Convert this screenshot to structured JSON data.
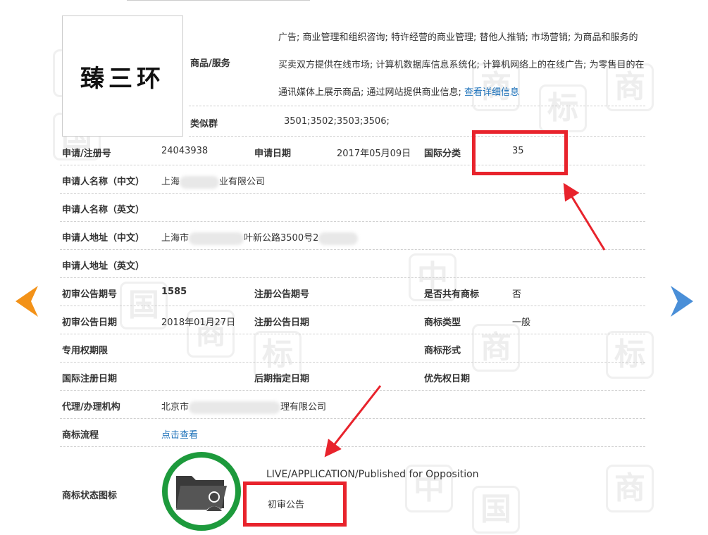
{
  "logo_text": "臻三环",
  "goods": {
    "label": "商品/服务",
    "text": "广告; 商业管理和组织咨询; 特许经营的商业管理; 替他人推销; 市场营销; 为商品和服务的买卖双方提供在线市场; 计算机数据库信息系统化; 计算机网络上的在线广告; 为零售目的在通讯媒体上展示商品; 通过网站提供商业信息; ",
    "link": "查看详细信息"
  },
  "similar_group": {
    "label": "类似群",
    "value": "3501;3502;3503;3506;"
  },
  "reg_no": {
    "label": "申请/注册号",
    "value": "24043938"
  },
  "apply_date": {
    "label": "申请日期",
    "value": "2017年05月09日"
  },
  "intl_class": {
    "label": "国际分类",
    "value": "35"
  },
  "applicant_cn": {
    "label": "申请人名称（中文）",
    "value_prefix": "上海",
    "value_suffix": "业有限公司"
  },
  "applicant_en": {
    "label": "申请人名称（英文）"
  },
  "address_cn": {
    "label": "申请人地址（中文）",
    "value_prefix": "上海市",
    "value_mid": "叶新公路3500号2"
  },
  "address_en": {
    "label": "申请人地址（英文）"
  },
  "prelim_issue": {
    "label": "初审公告期号",
    "value": "1585"
  },
  "reg_issue": {
    "label": "注册公告期号"
  },
  "shared": {
    "label": "是否共有商标",
    "value": "否"
  },
  "prelim_date": {
    "label": "初审公告日期",
    "value": "2018年01月27日"
  },
  "reg_date": {
    "label": "注册公告日期"
  },
  "mark_type": {
    "label": "商标类型",
    "value": "一般"
  },
  "exclusive_period": {
    "label": "专用权期限"
  },
  "mark_form": {
    "label": "商标形式"
  },
  "intl_reg_date": {
    "label": "国际注册日期"
  },
  "later_date": {
    "label": "后期指定日期"
  },
  "priority_date": {
    "label": "优先权日期"
  },
  "agent": {
    "label": "代理/办理机构",
    "value_prefix": "北京市",
    "value_suffix": "理有限公司"
  },
  "flow": {
    "label": "商标流程",
    "link": "点击查看"
  },
  "status": {
    "label": "商标状态图标",
    "english": "LIVE/APPLICATION/Published for Opposition",
    "chinese": "初审公告"
  },
  "colors": {
    "accent_red": "#e8232c",
    "ring_green": "#1d9a3c",
    "link_blue": "#1a6fb8",
    "nav_orange": "#f39218",
    "nav_blue": "#4a8fd8"
  }
}
